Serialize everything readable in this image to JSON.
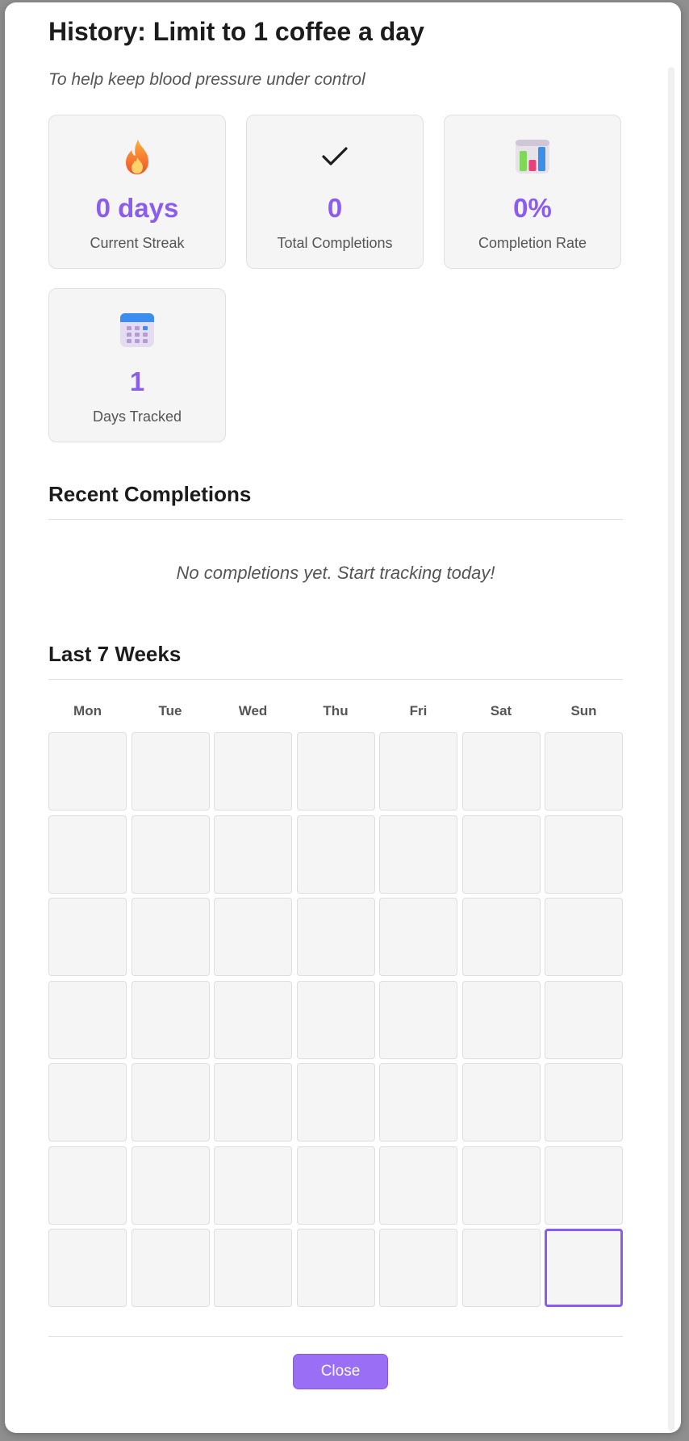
{
  "modal": {
    "title": "History: Limit to 1 coffee a day",
    "subtitle": "To help keep blood pressure under control",
    "close_label": "Close"
  },
  "stats": [
    {
      "icon": "fire-icon",
      "value": "0 days",
      "label": "Current Streak"
    },
    {
      "icon": "checkmark-icon",
      "value": "0",
      "label": "Total Completions"
    },
    {
      "icon": "bar-chart-icon",
      "value": "0%",
      "label": "Completion Rate"
    },
    {
      "icon": "calendar-icon",
      "value": "1",
      "label": "Days Tracked"
    }
  ],
  "recent": {
    "heading": "Recent Completions",
    "empty_message": "No completions yet. Start tracking today!"
  },
  "calendar": {
    "heading": "Last 7 Weeks",
    "weekdays": [
      "Mon",
      "Tue",
      "Wed",
      "Thu",
      "Fri",
      "Sat",
      "Sun"
    ],
    "weeks": 7,
    "today_week": 7,
    "today_weekday": "Sun"
  },
  "colors": {
    "accent": "#8a5cf0",
    "button": "#9b6ff5",
    "card_bg": "#f5f5f5"
  }
}
